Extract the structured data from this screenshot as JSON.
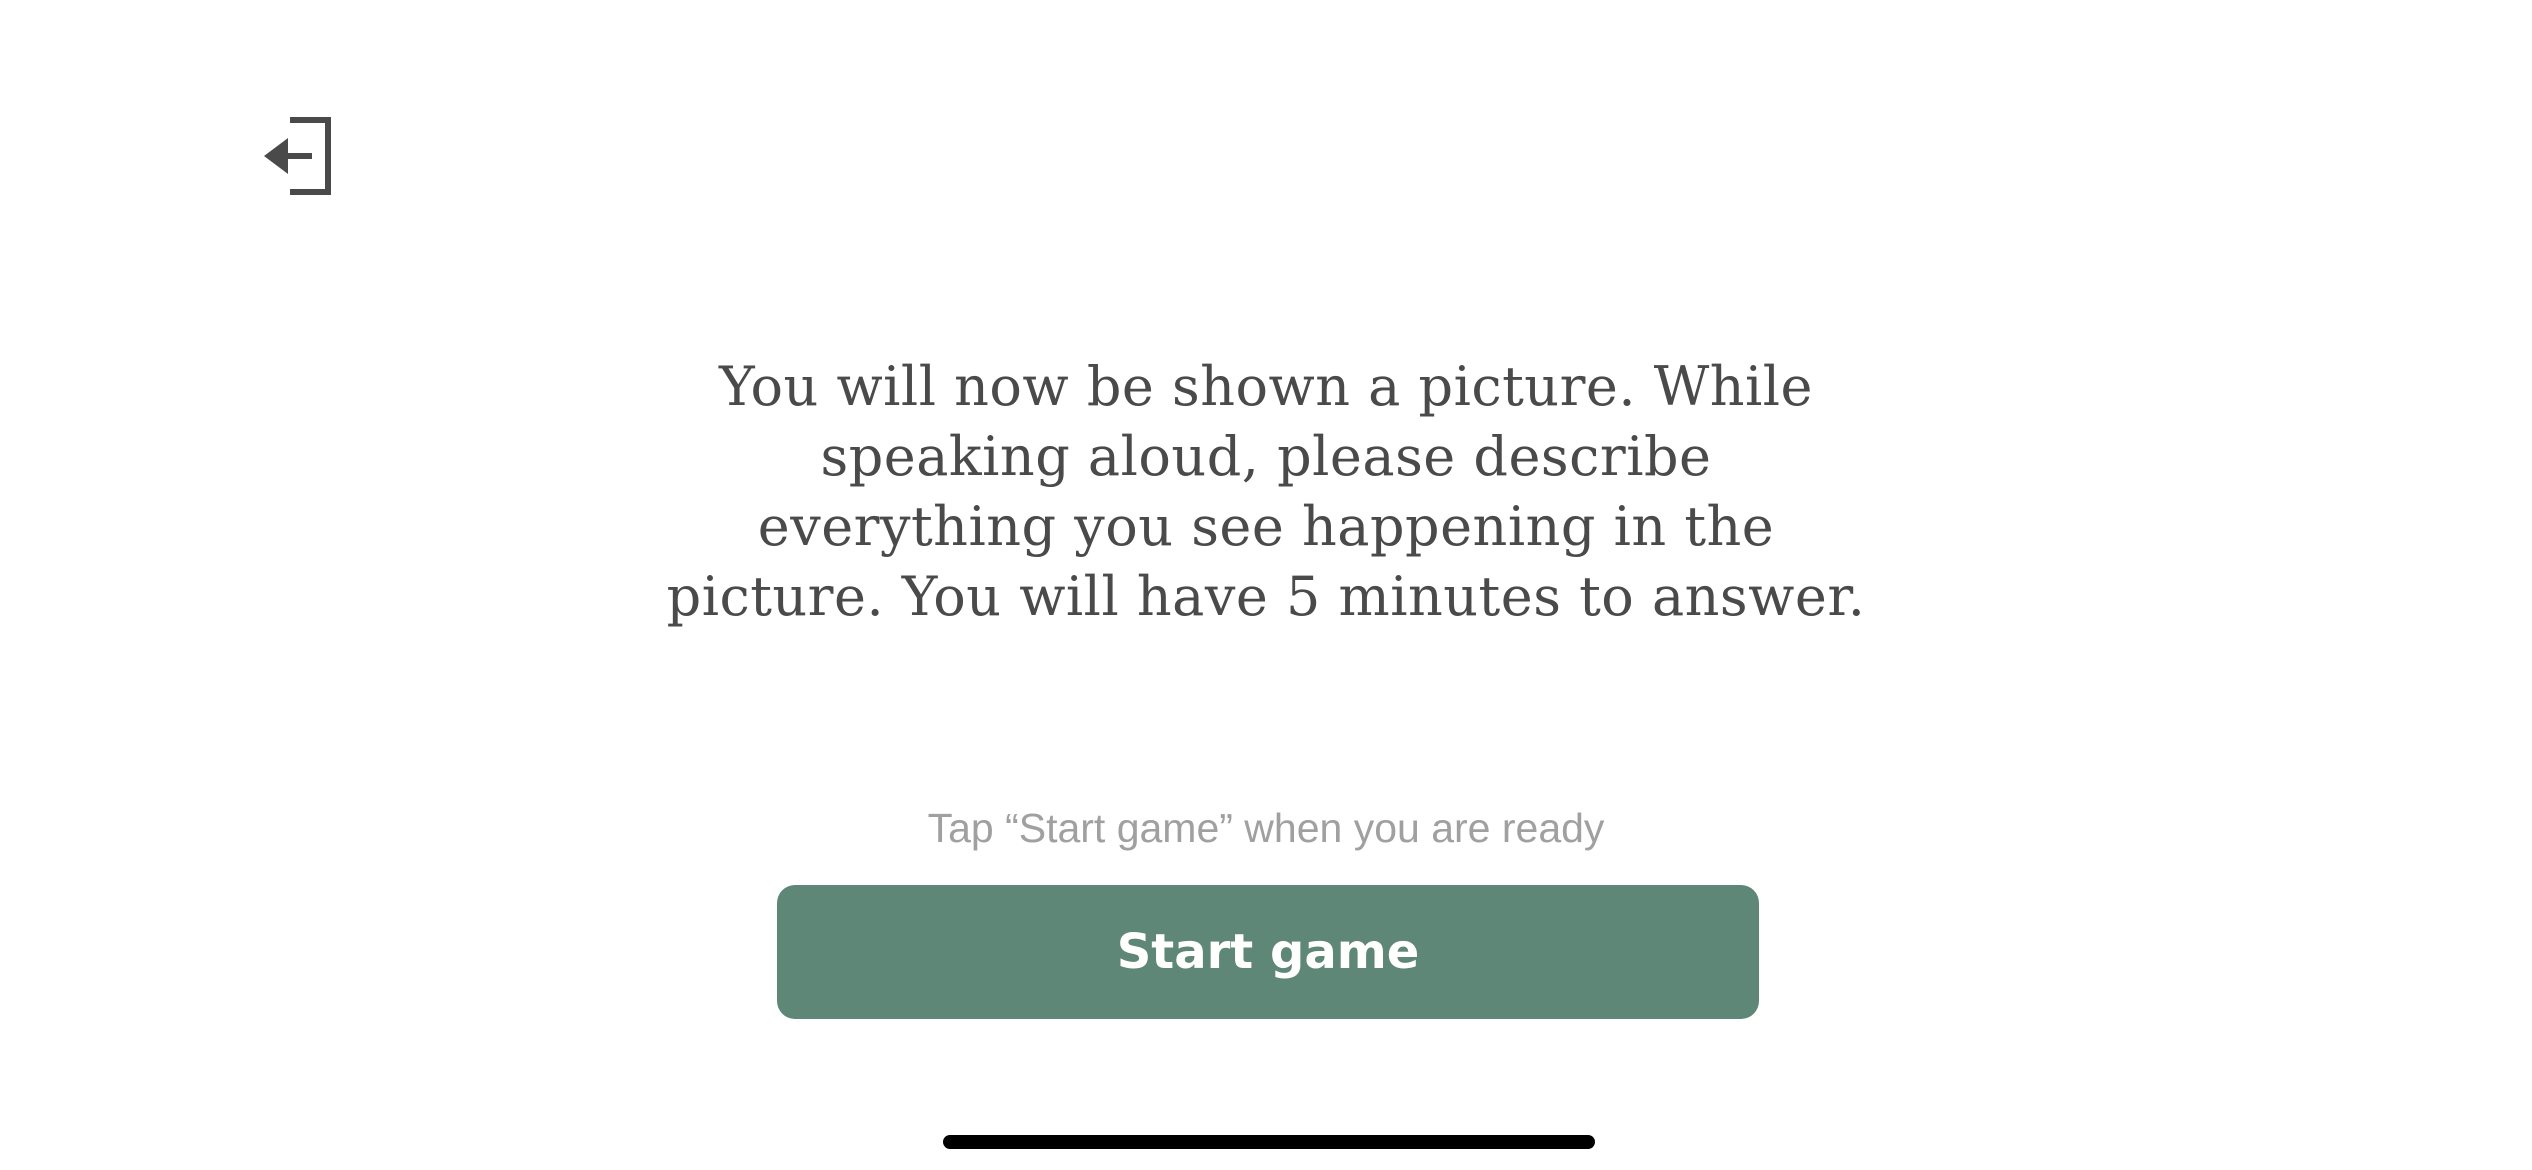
{
  "header": {
    "exit_icon": "exit-arrow-icon"
  },
  "main": {
    "instructions": "You will now be shown a picture. While speaking aloud, please describe everything you see happening in the picture. You will have 5 minutes to answer.",
    "hint": "Tap “Start game” when you are ready",
    "start_button_label": "Start game"
  },
  "colors": {
    "accent": "#5f8777",
    "text": "#4a4a4a",
    "hint": "#a0a0a0",
    "background": "#ffffff"
  }
}
